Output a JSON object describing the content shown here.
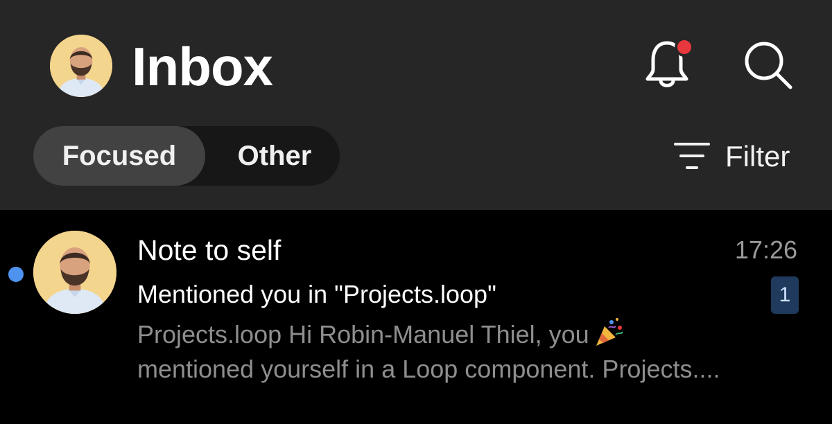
{
  "header": {
    "title": "Inbox",
    "avatar_icon": "user-avatar",
    "notification_icon": "bell-icon",
    "has_notification": true,
    "search_icon": "search-icon"
  },
  "tabs": [
    {
      "label": "Focused",
      "selected": true
    },
    {
      "label": "Other",
      "selected": false
    }
  ],
  "filter": {
    "label": "Filter",
    "icon": "filter-icon"
  },
  "messages": [
    {
      "unread": true,
      "sender": "Note to self",
      "time": "17:26",
      "subject": "Mentioned you in \"Projects.loop\"",
      "count_badge": "1",
      "preview_line1": "Projects.loop Hi Robin-Manuel Thiel, you",
      "preview_icon": "party-popper-icon",
      "preview_line2": "mentioned yourself in a Loop component. Projects...."
    }
  ],
  "colors": {
    "header_bg": "#262626",
    "list_bg": "#000000",
    "notification_dot": "#e8383d",
    "unread_dot": "#4f93f0",
    "badge_bg": "#1f3a5c"
  }
}
